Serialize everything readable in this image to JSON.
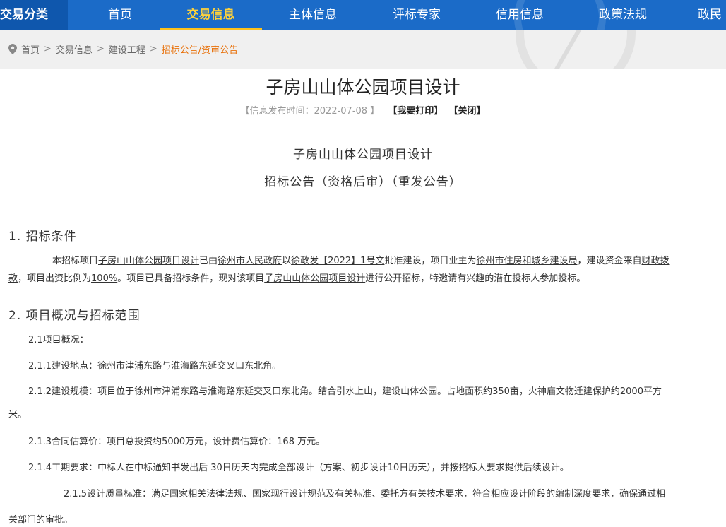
{
  "nav": {
    "category": "交易分类",
    "items": [
      {
        "label": "首页"
      },
      {
        "label": "交易信息"
      },
      {
        "label": "主体信息"
      },
      {
        "label": "评标专家"
      },
      {
        "label": "信用信息"
      },
      {
        "label": "政策法规"
      },
      {
        "label": "政民"
      }
    ],
    "active_index": 1,
    "colors": {
      "bar": "#1b6bc8",
      "category_bg": "#0f57ad",
      "active_text": "#ffd23a",
      "active_underline": "#ffc21a"
    }
  },
  "breadcrumb": {
    "icon": "location-pin-icon",
    "items": [
      "首页",
      "交易信息",
      "建设工程"
    ],
    "separator": ">",
    "current": "招标公告/资审公告"
  },
  "article": {
    "title": "子房山山体公园项目设计",
    "publish_prefix": "【信息发布时间：",
    "publish_date": "2022-07-08",
    "publish_suffix": " 】",
    "print_label": "【我要打印】",
    "close_label": "【关闭】",
    "subtitle_1": "子房山山体公园项目设计",
    "subtitle_2": "招标公告（资格后审）（重发公告）",
    "section1_heading": "1.  招标条件",
    "section1": {
      "t1": "本招标项目",
      "project_name": "子房山山体公园项目设计",
      "t2": "已由",
      "approver": "徐州市人民政府",
      "t3": "以",
      "approval_doc": "徐政发【2022】1号文",
      "t4": "批准建设，项目业主为",
      "owner": "徐州市住房和城乡建设局",
      "t5": "，建设资金来自",
      "fund_source": "财政拨",
      "fund_source_cont": "款",
      "t6": "，项目出资比例为",
      "ratio": "100%",
      "t7": "。项目已具备招标条件，现对该项目",
      "project_name_2": "子房山山体公园项目设计",
      "t8": "进行公开招标，特邀请有兴趣的潜在投标人参加投标。"
    },
    "section2_heading": "2.  项目概况与招标范围",
    "s21": "2.1项目概况：",
    "s211": "2.1.1建设地点：徐州市津浦东路与淮海路东延交叉口东北角。",
    "s212_a": "2.1.2建设规模：项目位于徐州市津浦东路与淮海路东延交叉口东北角。结合引水上山，建设山体公园。占地面积约350亩，火神庙文物迁建保护约2000平方",
    "s212_b": "米。",
    "s213": "2.1.3合同估算价：项目总投资约5000万元，设计费估算价：168 万元。",
    "s214": "2.1.4工期要求：中标人在中标通知书发出后 30日历天内完成全部设计（方案、初步设计10日历天），并按招标人要求提供后续设计。",
    "s215_a": "2.1.5设计质量标准：满足国家相关法律法规、国家现行设计规范及有关标准、委托方有关技术要求，符合相应设计阶段的编制深度要求，确保通过相",
    "s215_b": "关部门的审批。"
  }
}
